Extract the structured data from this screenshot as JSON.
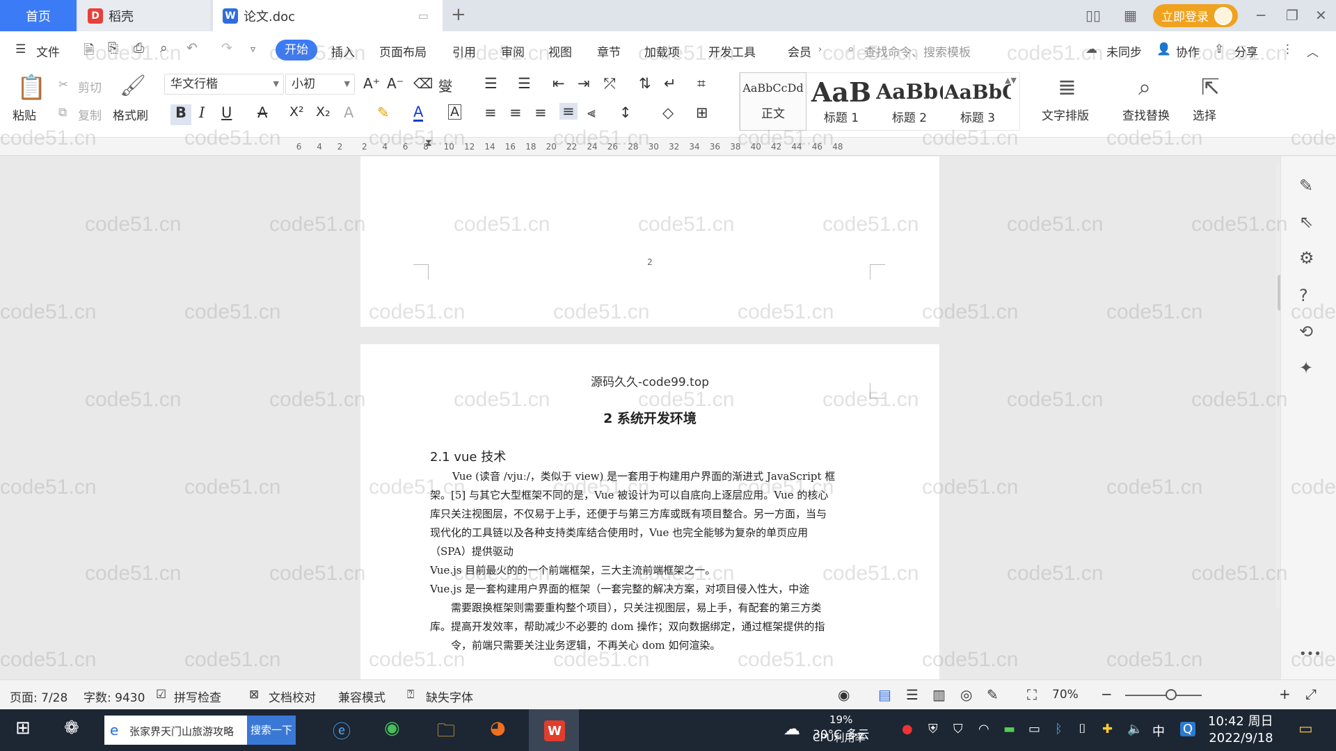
{
  "titlebar": {
    "tab_home": "首页",
    "tab_daoke": "稻壳",
    "tab_doc": "论文.doc",
    "login": "立即登录"
  },
  "menus": [
    "文件",
    "开始",
    "插入",
    "页面布局",
    "引用",
    "审阅",
    "视图",
    "章节",
    "加载项",
    "开发工具",
    "会员"
  ],
  "menu_search": "查找命令、搜索模板",
  "menu_right": {
    "sync": "未同步",
    "collab": "协作",
    "share": "分享"
  },
  "ribbon": {
    "paste": "粘贴",
    "cut": "剪切",
    "copy": "复制",
    "format_painter": "格式刷",
    "font": "华文行楷",
    "size": "小初",
    "styles": [
      {
        "preview": "AaBbCcDd",
        "label": "正文"
      },
      {
        "preview": "AaB",
        "label": "标题 1"
      },
      {
        "preview": "AaBb(",
        "label": "标题 2"
      },
      {
        "preview": "AaBbC",
        "label": "标题 3"
      }
    ],
    "text_layout": "文字排版",
    "find_replace": "查找替换",
    "select": "选择"
  },
  "ruler_ticks": [
    "6",
    "4",
    "2",
    "2",
    "4",
    "6",
    "8",
    "10",
    "12",
    "14",
    "16",
    "18",
    "20",
    "22",
    "24",
    "26",
    "28",
    "30",
    "32",
    "34",
    "36",
    "38",
    "40",
    "42",
    "44",
    "46",
    "48"
  ],
  "document": {
    "prev_page_number": "2",
    "header": "源码久久-code99.top",
    "chapter": "2  系统开发环境",
    "section": "2.1  vue 技术",
    "para1": [
      "Vue (读音 /vjuː/，类似于 view) 是一套用于构建用户界面的渐进式 JavaScript 框",
      "架。[5] 与其它大型框架不同的是，Vue 被设计为可以自底向上逐层应用。Vue 的核心",
      "库只关注视图层，不仅易于上手，还便于与第三方库或既有项目整合。另一方面，当与",
      "现代化的工具链以及各种支持类库结合使用时，Vue 也完全能够为复杂的单页应用",
      "（SPA）提供驱动"
    ],
    "para2": "Vue.js 目前最火的的一个前端框架，三大主流前端框架之一。",
    "para3": [
      "Vue.js 是一套构建用户界面的框架（一套完整的解决方案，对项目侵入性大，中途",
      "需要跟换框架则需要重构整个项目），只关注视图层，易上手，有配套的第三方类",
      "库。提高开发效率，帮助减少不必要的 dom 操作；双向数据绑定，通过框架提供的指",
      "令，前端只需要关注业务逻辑，不再关心 dom 如何渲染。"
    ]
  },
  "status": {
    "page": "页面: 7/28",
    "words": "字数: 9430",
    "spell": "拼写检查",
    "proof": "文档校对",
    "compat": "兼容模式",
    "missing_font": "缺失字体",
    "zoom": "70%"
  },
  "taskbar": {
    "search_text": "张家界天门山旅游攻略",
    "search_button": "搜索一下",
    "weather": "30°C 多云",
    "cpu": "19%",
    "cpu_label": "CPU利用率",
    "ime": "中",
    "time": "10:42 周日",
    "date": "2022/9/18"
  },
  "watermark": "code51.cn"
}
